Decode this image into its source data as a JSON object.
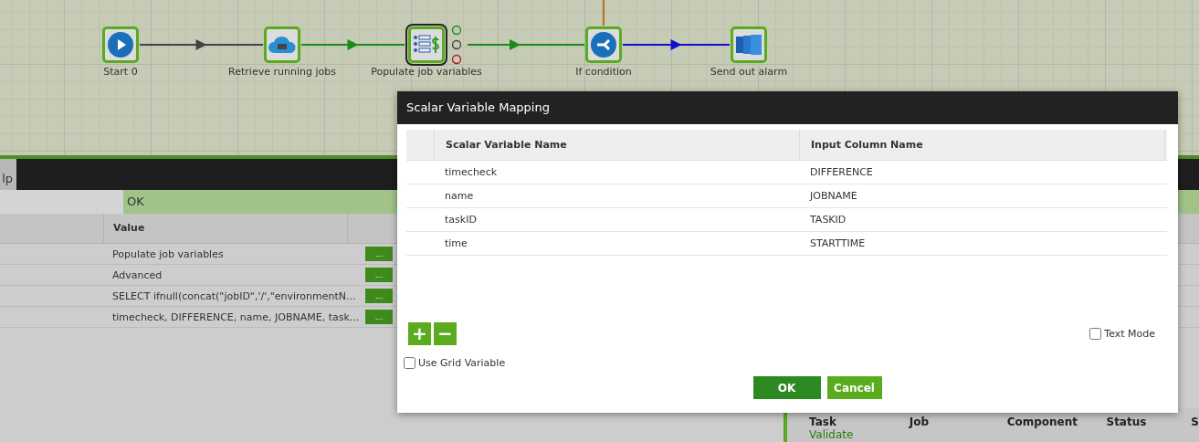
{
  "canvas": {
    "nodes": [
      {
        "label": "Start 0",
        "kind": "start",
        "selected": false
      },
      {
        "label": "Retrieve running jobs",
        "kind": "cloud",
        "selected": false
      },
      {
        "label": "Populate job variables",
        "kind": "variables",
        "selected": true
      },
      {
        "label": "If condition",
        "kind": "branch",
        "selected": false
      },
      {
        "label": "Send out alarm",
        "kind": "alarm",
        "selected": false
      }
    ],
    "connectors": [
      {
        "kind": "unconditional"
      },
      {
        "kind": "success"
      },
      {
        "kind": "success"
      },
      {
        "kind": "true"
      }
    ]
  },
  "panel": {
    "tabs": [
      {
        "label": "lp",
        "selected": true
      }
    ],
    "status": "OK",
    "properties": {
      "columns": [
        "Value"
      ],
      "rows": [
        {
          "value": "Populate job variables",
          "button": "..."
        },
        {
          "value": "Advanced",
          "button": "..."
        },
        {
          "value": "SELECT ifnull(concat(\"jobID\",'/',\"environmentN...",
          "button": "..."
        },
        {
          "value": "timecheck, DIFFERENCE, name, JOBNAME, task...",
          "button": "..."
        }
      ]
    }
  },
  "tasks": {
    "columns": [
      "Task",
      "Job",
      "Component",
      "Status",
      "S"
    ],
    "rows": [
      {
        "task": "Validate"
      }
    ]
  },
  "dialog": {
    "title": "Scalar Variable Mapping",
    "columns": [
      "Scalar Variable Name",
      "Input Column Name"
    ],
    "rows": [
      {
        "name": "timecheck",
        "input": "DIFFERENCE"
      },
      {
        "name": "name",
        "input": "JOBNAME"
      },
      {
        "name": "taskID",
        "input": "TASKID"
      },
      {
        "name": "time",
        "input": "STARTTIME"
      }
    ],
    "add_button": "+",
    "remove_button": "−",
    "text_mode": {
      "label": "Text Mode",
      "checked": false
    },
    "use_grid": {
      "label": "Use Grid Variable",
      "checked": false
    },
    "buttons": [
      {
        "label": "OK",
        "kind": "primary"
      },
      {
        "label": "Cancel",
        "kind": "secondary"
      }
    ]
  }
}
